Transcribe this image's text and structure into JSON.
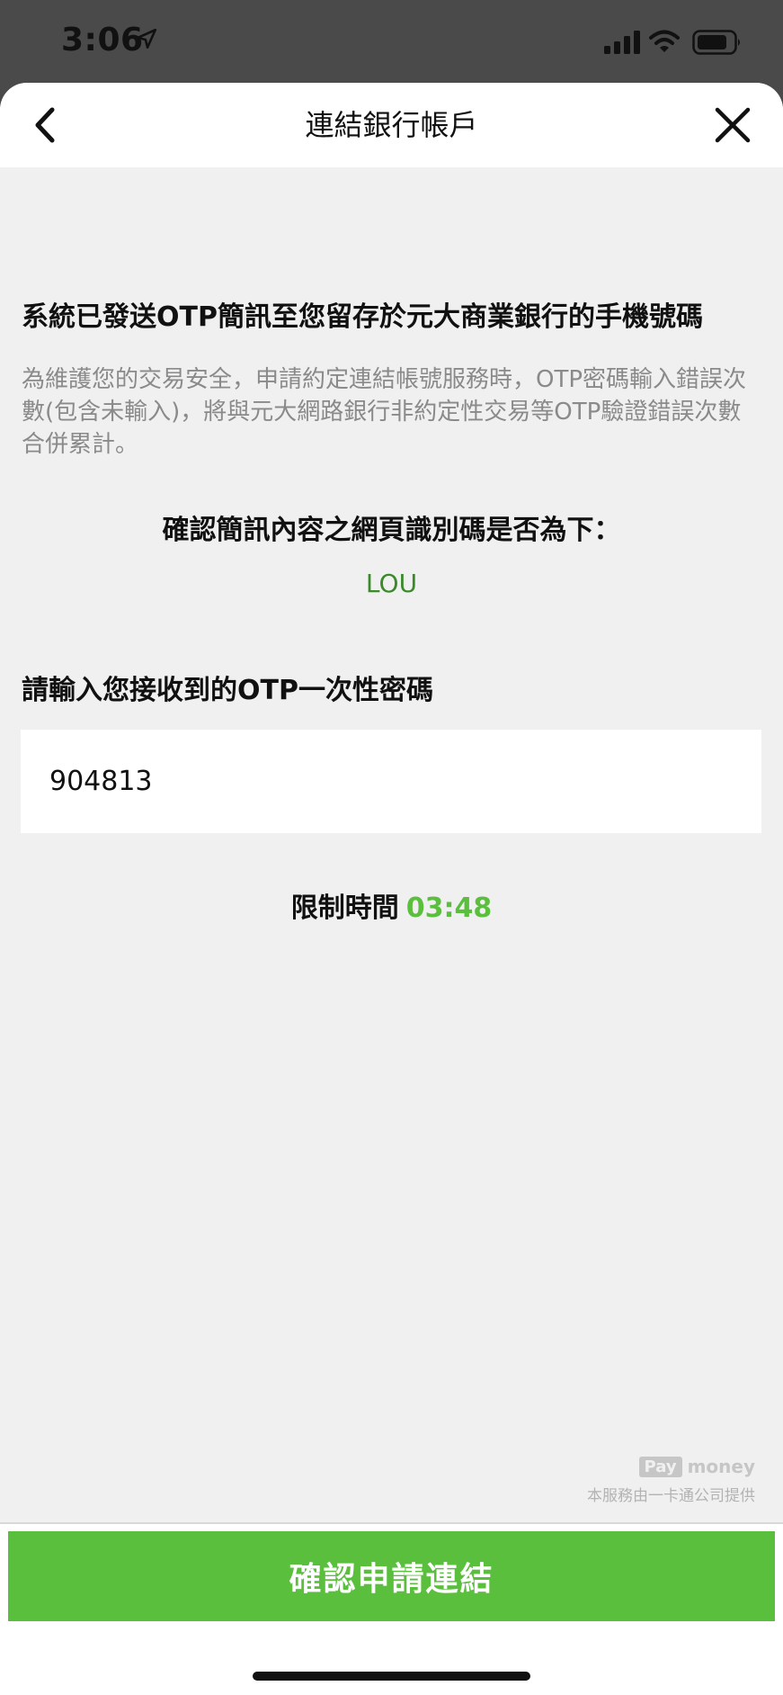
{
  "status_bar": {
    "time": "3:06"
  },
  "nav": {
    "title": "連結銀行帳戶"
  },
  "otp_page": {
    "sent_heading": "系統已發送OTP簡訊至您留存於元大商業銀行的手機號碼",
    "notice": "為維護您的交易安全，申請約定連結帳號服務時，OTP密碼輸入錯誤次數(包含未輸入)，將與元大網路銀行非約定性交易等OTP驗證錯誤次數合併累計。",
    "confirm_label": "確認簡訊內容之網頁識別碼是否為下：",
    "web_code": "LOU",
    "otp_label": "請輸入您接收到的OTP一次性密碼",
    "otp_value": "904813",
    "timer_label": "限制時間",
    "timer_value": "03:48"
  },
  "provider": {
    "logo_pay": "Pay",
    "logo_money": "money",
    "text": "本服務由一卡通公司提供"
  },
  "footer": {
    "confirm_button": "確認申請連結"
  },
  "colors": {
    "accent": "#5bbf3e",
    "code_green": "#3a8a2a",
    "background": "#f0f0f0"
  },
  "icons": {
    "back": "chevron-left-icon",
    "close": "close-icon",
    "location": "location-arrow-icon",
    "signal": "cellular-signal-icon",
    "wifi": "wifi-icon",
    "battery": "battery-icon"
  }
}
